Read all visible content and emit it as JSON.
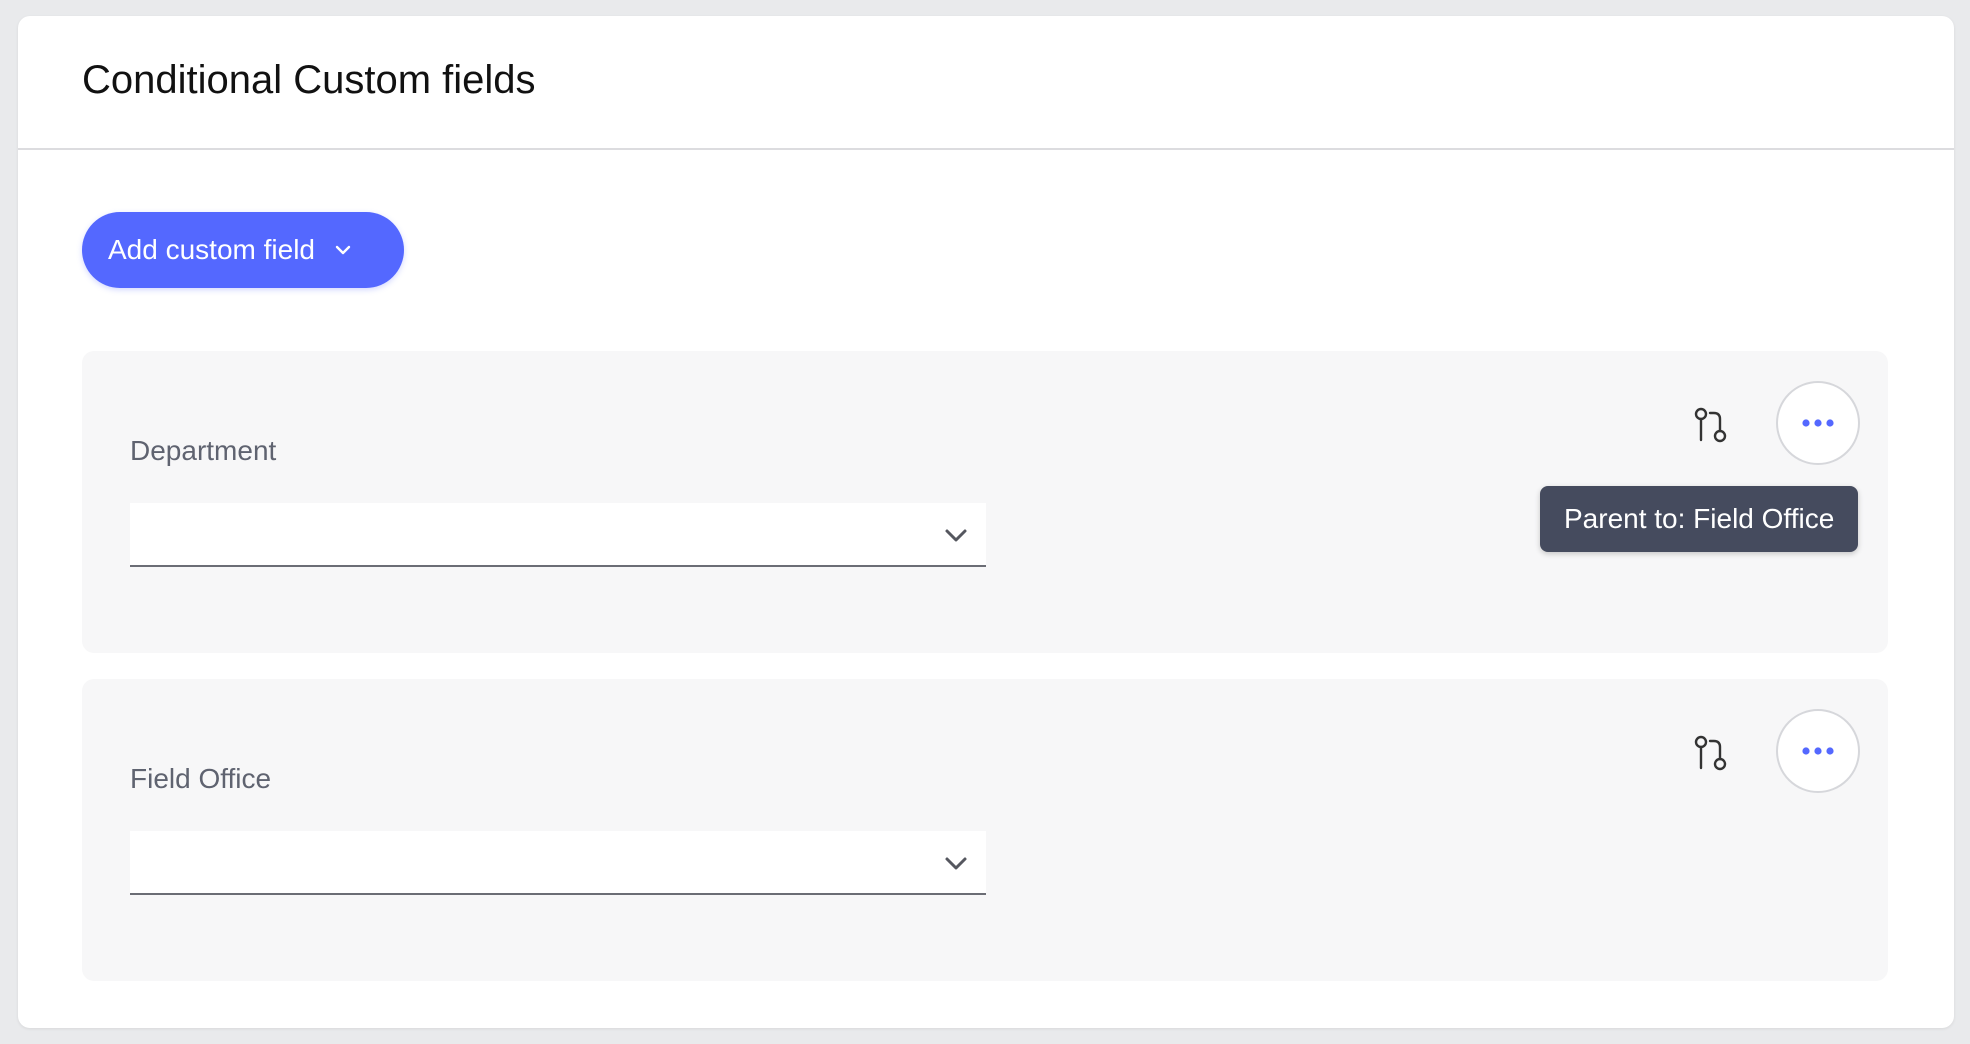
{
  "header": {
    "title": "Conditional Custom fields"
  },
  "toolbar": {
    "add_button_label": "Add custom field",
    "add_button_icon": "chevron-down-icon"
  },
  "fields": [
    {
      "label": "Department",
      "value": "",
      "branch_icon": "branch-icon",
      "more_icon": "more-horizontal-icon"
    },
    {
      "label": "Field Office",
      "value": "",
      "branch_icon": "branch-icon",
      "more_icon": "more-horizontal-icon"
    }
  ],
  "tooltip": {
    "text": "Parent to: Field Office"
  },
  "colors": {
    "accent": "#5468ff",
    "tooltip_bg": "#454b5e",
    "panel_bg": "#f7f7f8",
    "page_bg": "#e9eaec"
  }
}
